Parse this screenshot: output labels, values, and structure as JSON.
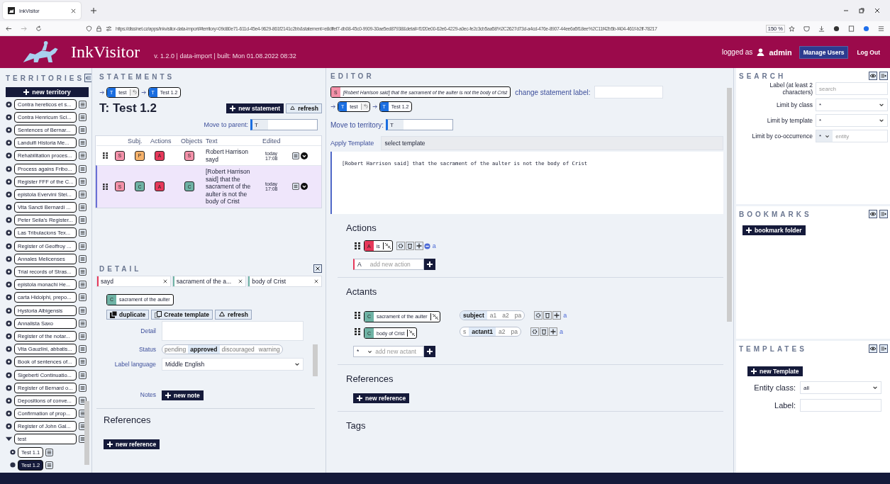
{
  "browser": {
    "tab_title": "InkVisitor",
    "url": "https://dissinet.cz/apps/inkvisitor-data-import/#territory=09d80e71-611d-45e4-9629-861f2141c2bb&statement=e8dffef7-db08-45c0-9909-30ae5ed87938&detail=f1f20e00-62e6-4229-a0ec-fe2c3cb5aa58%2C2627d73d-a4cd-476e-8907-44ee6a5f18ee%2C11f42b5b-f404-461f-b2ff-78217",
    "zoom": "150 %"
  },
  "header": {
    "app_name": "InkVisitor",
    "version": "v. 1.2.0 | data-import | built: Mon 01.08.2022 08:32",
    "logged_as": "logged as",
    "user": "admin",
    "buttons": [
      "Manage Users",
      "Log Out"
    ]
  },
  "territories": {
    "title": "TERRITORIES",
    "new_button": "new territory",
    "items": [
      {
        "label": "Contra hereticos et s...",
        "expanded": false,
        "selected": false
      },
      {
        "label": "Contra Henricum Sci...",
        "expanded": false,
        "selected": false
      },
      {
        "label": "Sentences of Bernar...",
        "expanded": false,
        "selected": false
      },
      {
        "label": "Landulfi Historia Me...",
        "expanded": false,
        "selected": false
      },
      {
        "label": "Rehabilitation proces...",
        "expanded": false,
        "selected": false
      },
      {
        "label": "Process agains Fribo...",
        "expanded": false,
        "selected": false
      },
      {
        "label": "Register FFF of the C...",
        "expanded": false,
        "selected": false
      },
      {
        "label": "epistola Evervini Stei...",
        "expanded": false,
        "selected": false
      },
      {
        "label": "Vita Sancti Bernardi ...",
        "expanded": false,
        "selected": false
      },
      {
        "label": "Peter Seila's Register...",
        "expanded": false,
        "selected": false
      },
      {
        "label": "Las Tribulacions Tex...",
        "expanded": false,
        "selected": false
      },
      {
        "label": "Register of Geoffroy ...",
        "expanded": false,
        "selected": false
      },
      {
        "label": "Annales Melicenses",
        "expanded": false,
        "selected": false
      },
      {
        "label": "Trial records of Stras...",
        "expanded": false,
        "selected": false
      },
      {
        "label": "epistola monachi He...",
        "expanded": false,
        "selected": false
      },
      {
        "label": "carta Hidolphi, prepo...",
        "expanded": false,
        "selected": false
      },
      {
        "label": "Hystoria Albigensis",
        "expanded": false,
        "selected": false
      },
      {
        "label": "Annalista Saxo",
        "expanded": false,
        "selected": false
      },
      {
        "label": "Register of the notar...",
        "expanded": false,
        "selected": false
      },
      {
        "label": "Vita Gauzlini, abbatis...",
        "expanded": false,
        "selected": false
      },
      {
        "label": "Book of sentences of...",
        "expanded": false,
        "selected": false
      },
      {
        "label": "Sigeberti Continuatio...",
        "expanded": false,
        "selected": false
      },
      {
        "label": "Register of Bernard o...",
        "expanded": false,
        "selected": false
      },
      {
        "label": "Depositions of conve...",
        "expanded": false,
        "selected": false
      },
      {
        "label": "Confirmation of prop...",
        "expanded": false,
        "selected": false
      },
      {
        "label": "Register of John Gal...",
        "expanded": false,
        "selected": false
      },
      {
        "label": "test",
        "expanded": true,
        "selected": false,
        "children": [
          {
            "label": "Test 1.1",
            "selected": false
          },
          {
            "label": "Test 1.2",
            "selected": true
          }
        ]
      }
    ]
  },
  "statements": {
    "title": "STATEMENTS",
    "breadcrumb": [
      {
        "letter": "T",
        "label": "test",
        "back": true
      },
      {
        "letter": "T",
        "label": "Test 1.2",
        "back": false
      }
    ],
    "heading": "T: Test 1.2",
    "buttons": [
      "new statement",
      "refresh"
    ],
    "move_label": "Move to parent:",
    "move_value": "T",
    "columns": [
      "Subj.",
      "Actions",
      "Objects",
      "Text",
      "Edited"
    ],
    "rows": [
      {
        "badges": [
          {
            "letter": "S",
            "color": "#f491a9"
          },
          {
            "letter": "P",
            "color": "#f6b26b"
          },
          {
            "letter": "A",
            "color": "#e6385a"
          },
          {
            "letter": "S",
            "color": "#f491a9"
          }
        ],
        "text": "Robert Harrison sayd",
        "edited_day": "today",
        "edited_time": "17:08",
        "selected": false
      },
      {
        "badges": [
          {
            "letter": "S",
            "color": "#f491a9"
          },
          {
            "letter": "C",
            "color": "#6fb3a5"
          },
          {
            "letter": "A",
            "color": "#e6385a"
          },
          {
            "letter": "C",
            "color": "#6fb3a5"
          }
        ],
        "text": "[Robert Harrison said] that the sacrament of the aulter is not the body of Crist",
        "edited_day": "today",
        "edited_time": "17:08",
        "selected": true
      }
    ]
  },
  "detail": {
    "title": "DETAIL",
    "tabs": [
      {
        "label": "sayd",
        "color": "#e6385a"
      },
      {
        "label": "sacrament of the a...",
        "color": "#6fb3a5"
      },
      {
        "label": "body of Crist",
        "color": "#6fb3a5"
      }
    ],
    "entity": {
      "letter": "C",
      "color": "#6fb3a5",
      "label": "sacrament of the aulter"
    },
    "buttons": [
      "duplicate",
      "Create template",
      "refresh"
    ],
    "detail_label": "Detail",
    "status_label": "Status",
    "status_options": [
      {
        "label": "pending",
        "selected": false
      },
      {
        "label": "approved",
        "selected": true
      },
      {
        "label": "discouraged",
        "selected": false
      },
      {
        "label": "warning",
        "selected": false
      }
    ],
    "language_label": "Label language",
    "language_value": "Middle English",
    "notes_label": "Notes",
    "notes_button": "new note",
    "references_title": "References",
    "references_button": "new reference"
  },
  "editor": {
    "title": "EDITOR",
    "statement_tag": {
      "letter": "S",
      "color": "#f491a9",
      "label": "[Robert Harrison said] that the sacrament of the aulter is not the body of Crist"
    },
    "change_label": "change statement label:",
    "breadcrumb": [
      {
        "letter": "T",
        "label": "test",
        "back": true
      },
      {
        "letter": "T",
        "label": "Test 1.2",
        "back": false
      }
    ],
    "move_label": "Move to territory:",
    "move_value": "T",
    "template_label": "Apply Template",
    "template_value": "select template",
    "text": "[Robert Harrison said] that the sacrament of the aulter is not the body of Crist",
    "actions": {
      "title": "Actions",
      "items": [
        {
          "letter": "A",
          "color": "#e6385a",
          "label": "is",
          "extra": "a"
        }
      ],
      "add_type": "A",
      "add_placeholder": "add new action"
    },
    "actants": {
      "title": "Actants",
      "items": [
        {
          "letter": "C",
          "color": "#6fb3a5",
          "label": "sacrament of the aulter",
          "positions": [
            {
              "label": "subject",
              "selected": true
            },
            {
              "label": "a1",
              "selected": false
            },
            {
              "label": "a2",
              "selected": false
            },
            {
              "label": "pa",
              "selected": false
            }
          ],
          "extra": "a"
        },
        {
          "letter": "C",
          "color": "#6fb3a5",
          "label": "body of Crist",
          "positions": [
            {
              "label": "s",
              "selected": false
            },
            {
              "label": "actant1",
              "selected": true
            },
            {
              "label": "a2",
              "selected": false
            },
            {
              "label": "pa",
              "selected": false
            }
          ],
          "extra": "a"
        }
      ],
      "add_type": "*",
      "add_placeholder": "add new actant"
    },
    "references": {
      "title": "References",
      "button": "new reference"
    },
    "tags": {
      "title": "Tags"
    }
  },
  "search": {
    "title": "SEARCH",
    "label_label": "Label (at least 2 characters)",
    "label_placeholder": "search",
    "class_label": "Limit by class",
    "class_value": "*",
    "template_label": "Limit by template",
    "template_value": "*",
    "cooc_label": "Limit by co-occurrence",
    "cooc_value": "*",
    "cooc_placeholder": "entity"
  },
  "bookmarks": {
    "title": "BOOKMARKS",
    "button": "bookmark folder"
  },
  "templates": {
    "title": "TEMPLATES",
    "button": "new Template",
    "class_label": "Entity class:",
    "class_value": "all",
    "label_label": "Label:"
  }
}
